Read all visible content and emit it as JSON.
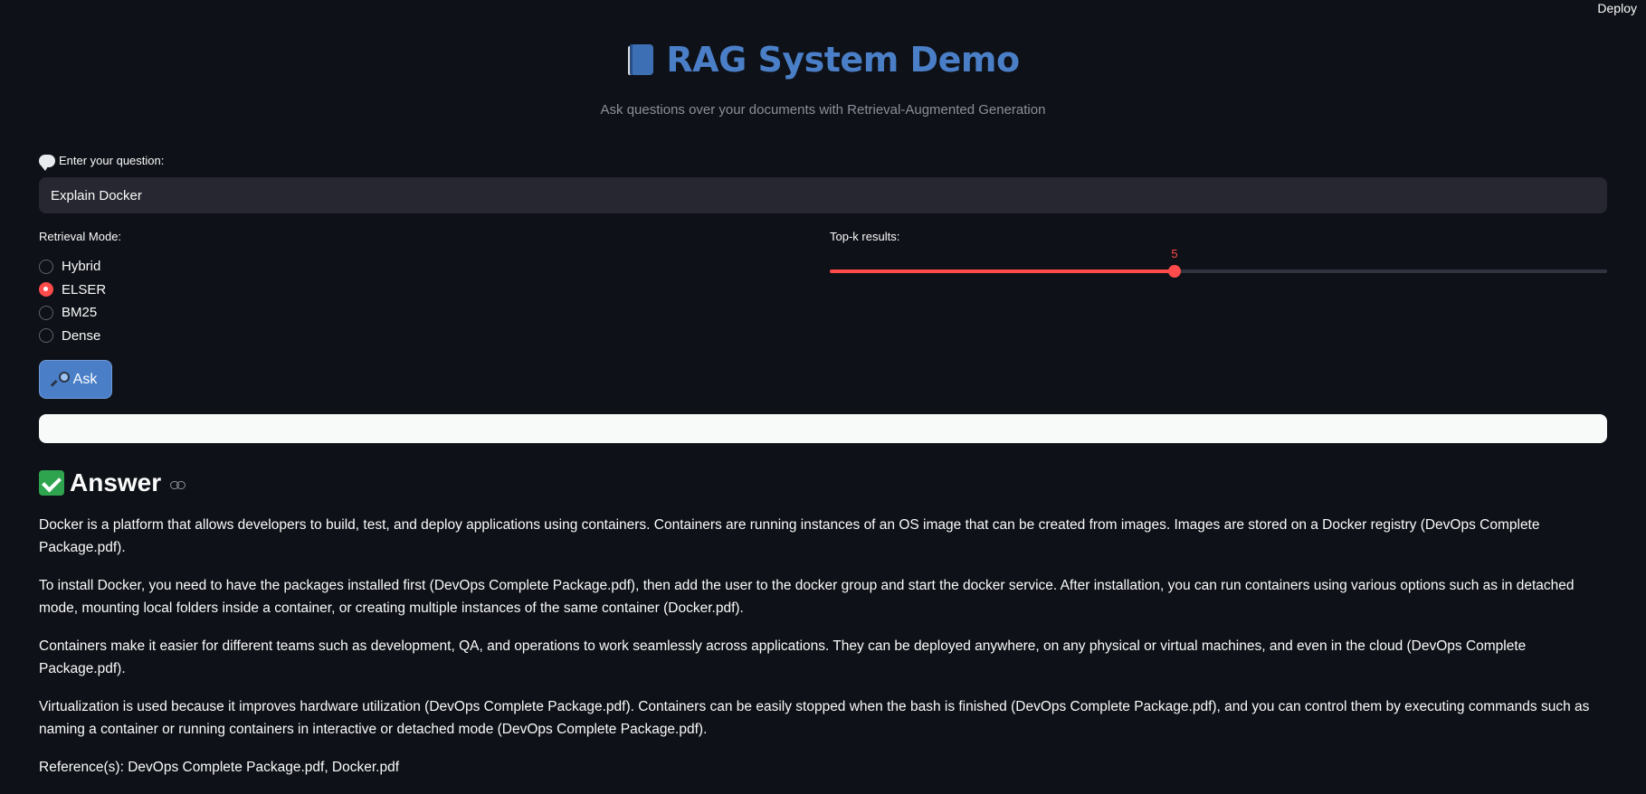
{
  "header": {
    "deploy_label": "Deploy"
  },
  "app": {
    "title": "RAG System Demo",
    "subtitle": "Ask questions over your documents with Retrieval-Augmented Generation",
    "title_color": "#4a7fc8",
    "accent_color": "#ff4b4b",
    "title_icon": "book-icon"
  },
  "question": {
    "label": "Enter your question:",
    "label_icon": "speech-balloon-icon",
    "value": "Explain Docker"
  },
  "retrieval": {
    "label": "Retrieval Mode:",
    "options": [
      "Hybrid",
      "ELSER",
      "BM25",
      "Dense"
    ],
    "selected": "ELSER"
  },
  "topk": {
    "label": "Top-k results:",
    "value": "5",
    "min": 1,
    "max": 10,
    "fraction": 0.444
  },
  "ask_button": {
    "label": "Ask",
    "icon": "magnifier-icon"
  },
  "progress": {
    "value": 1.0
  },
  "answer": {
    "heading": "Answer",
    "heading_icon": "check-mark-icon",
    "paragraphs": [
      "Docker is a platform that allows developers to build, test, and deploy applications using containers. Containers are running instances of an OS image that can be created from images. Images are stored on a Docker registry (DevOps Complete Package.pdf).",
      "To install Docker, you need to have the packages installed first (DevOps Complete Package.pdf), then add the user to the docker group and start the docker service. After installation, you can run containers using various options such as in detached mode, mounting local folders inside a container, or creating multiple instances of the same container (Docker.pdf).",
      "Containers make it easier for different teams such as development, QA, and operations to work seamlessly across applications. They can be deployed anywhere, on any physical or virtual machines, and even in the cloud (DevOps Complete Package.pdf).",
      "Virtualization is used because it improves hardware utilization (DevOps Complete Package.pdf). Containers can be easily stopped when the bash is finished (DevOps Complete Package.pdf), and you can control them by executing commands such as naming a container or running containers in interactive or detached mode (DevOps Complete Package.pdf).",
      "Reference(s): DevOps Complete Package.pdf, Docker.pdf"
    ]
  }
}
